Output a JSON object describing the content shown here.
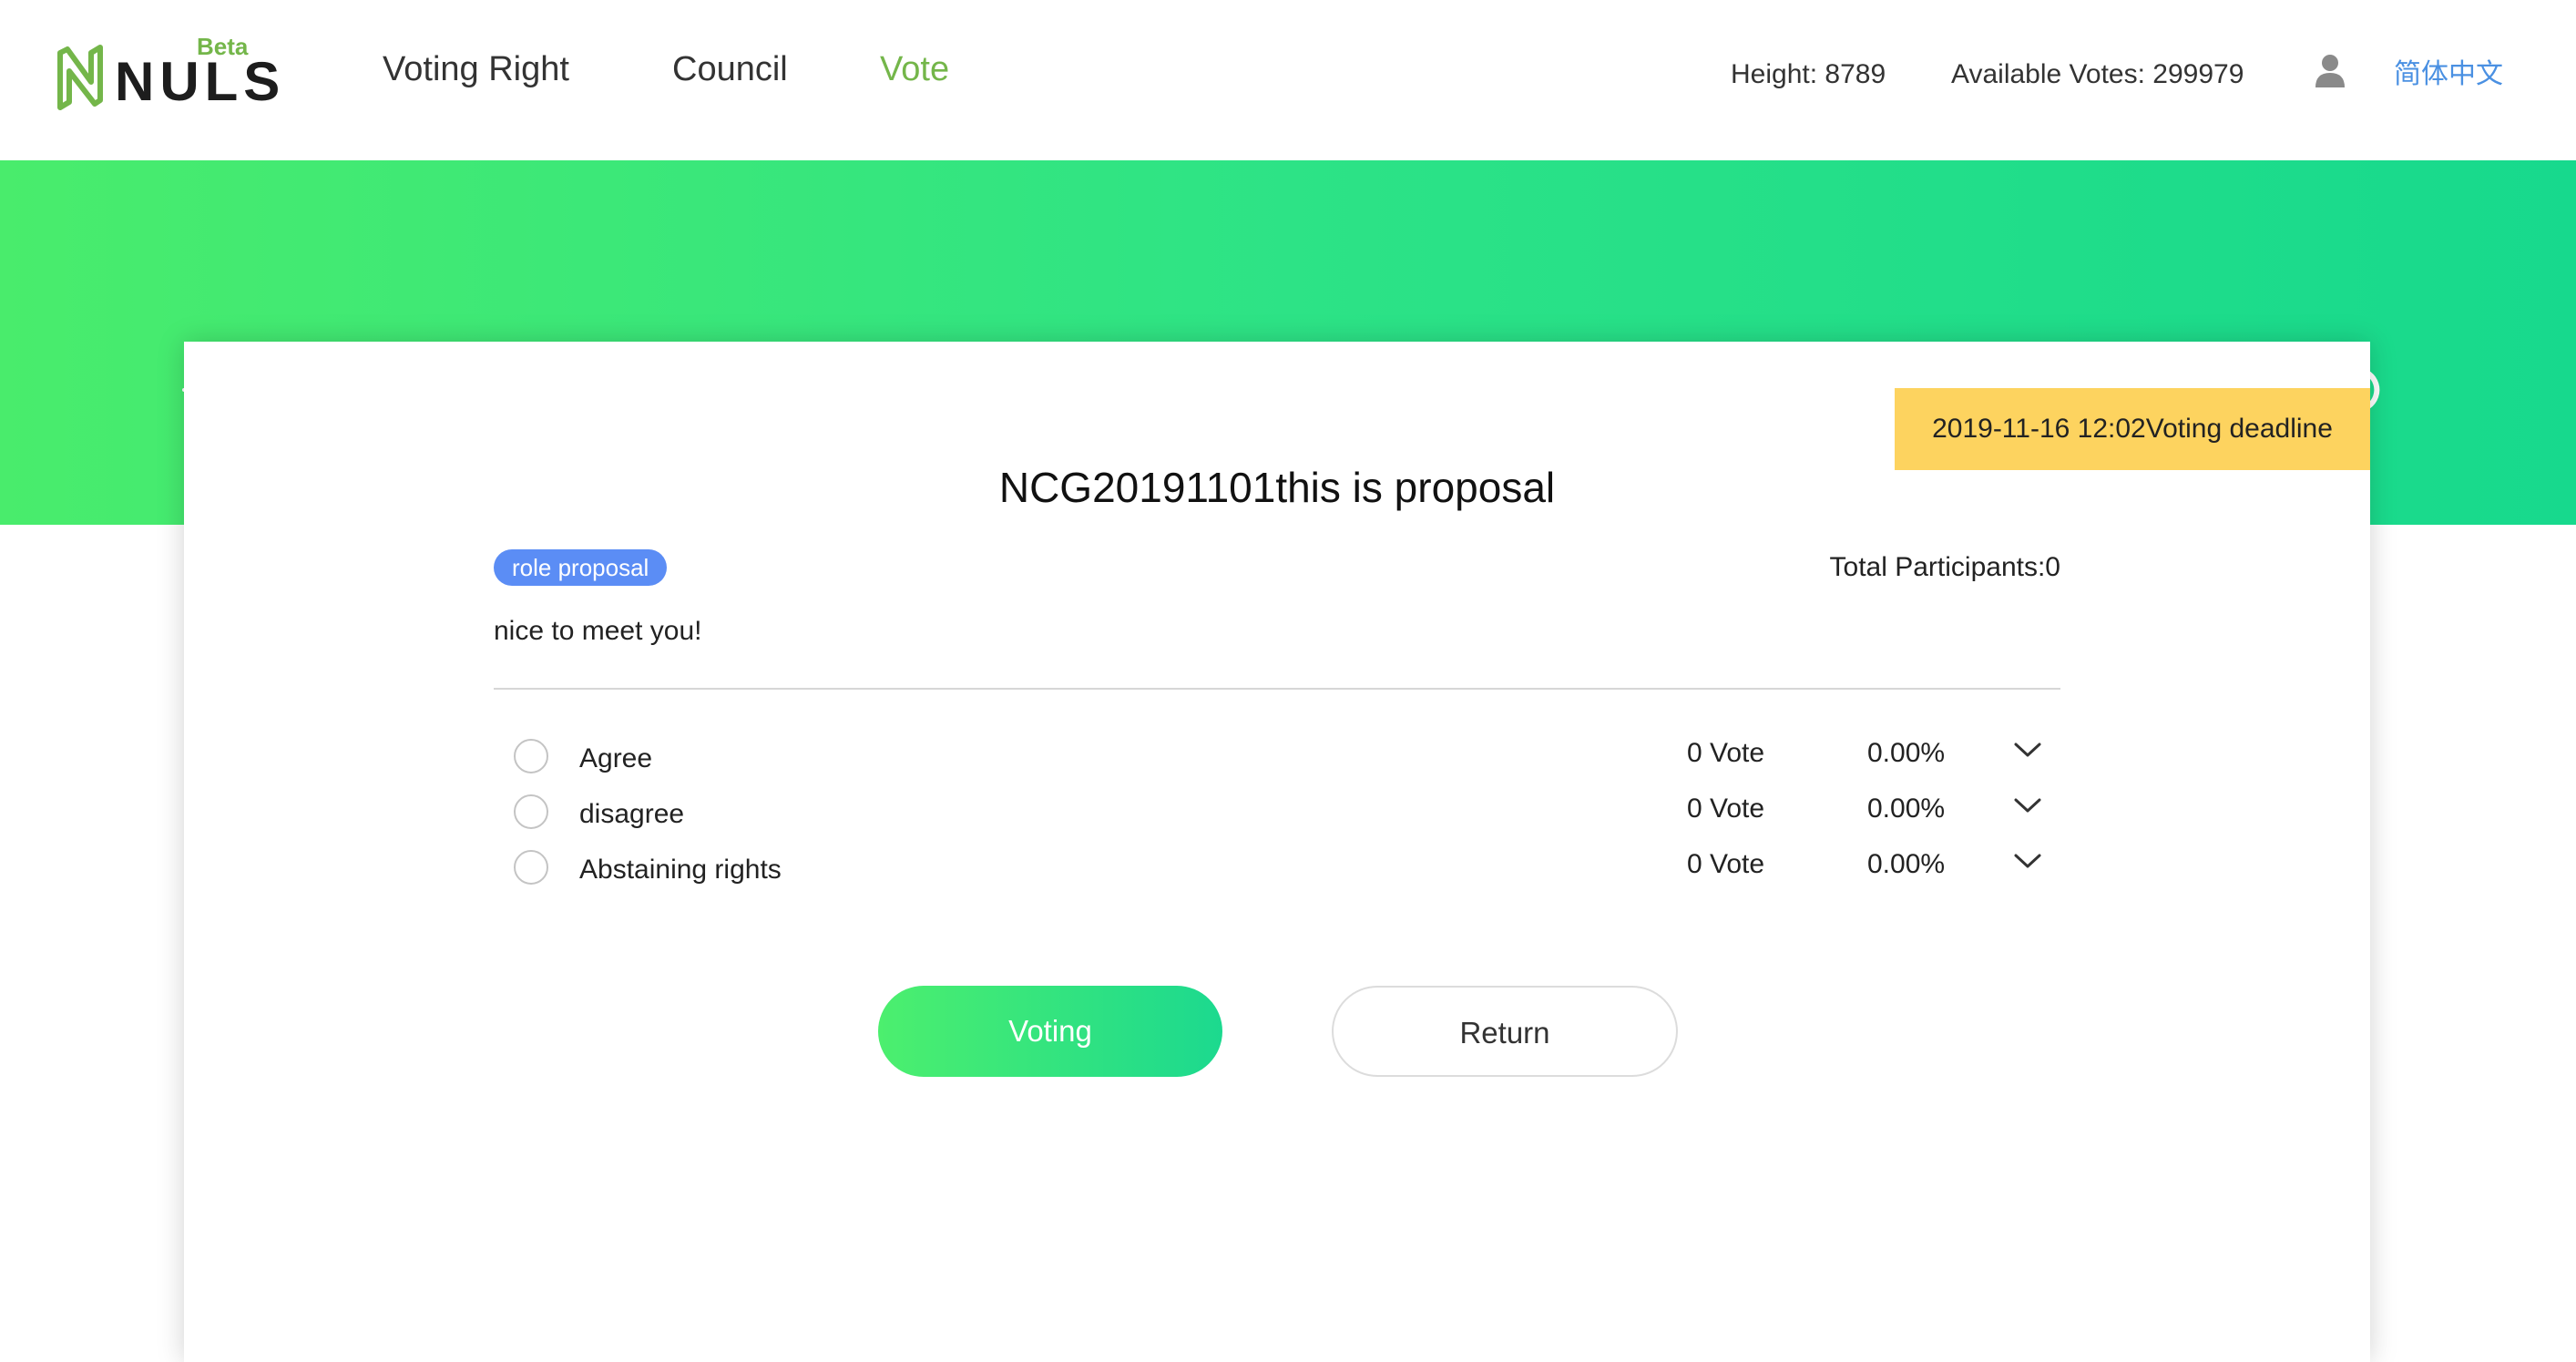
{
  "header": {
    "logo_text": "NULS",
    "beta_label": "Beta",
    "nav": [
      {
        "label": "Voting Right"
      },
      {
        "label": "Council"
      },
      {
        "label": "Vote"
      }
    ],
    "height_text": "Height: 8789",
    "available_votes_text": "Available Votes: 299979",
    "user_icon": "user-icon",
    "language": "简体中文",
    "accent_color": "#74b64a"
  },
  "banner": {
    "gradient": [
      "#49ec6c",
      "#17d98d"
    ],
    "icons": [
      "crosshair-icon",
      "link-icon",
      "ballot-box-icon",
      "heart-icon",
      "paper-plane-icon",
      "star-icon",
      "pie-chart-icon",
      "toggle-icon"
    ]
  },
  "proposal": {
    "deadline": "2019-11-16 12:02Voting deadline",
    "title": "NCG20191101this is proposal",
    "tag": "role proposal",
    "participants": "Total Participants:0",
    "description": "nice to meet you!",
    "options": [
      {
        "label": "Agree",
        "votes": "0 Vote",
        "percent": "0.00%"
      },
      {
        "label": "disagree",
        "votes": "0 Vote",
        "percent": "0.00%"
      },
      {
        "label": "Abstaining rights",
        "votes": "0 Vote",
        "percent": "0.00%"
      }
    ]
  },
  "actions": {
    "vote_label": "Voting",
    "return_label": "Return"
  }
}
